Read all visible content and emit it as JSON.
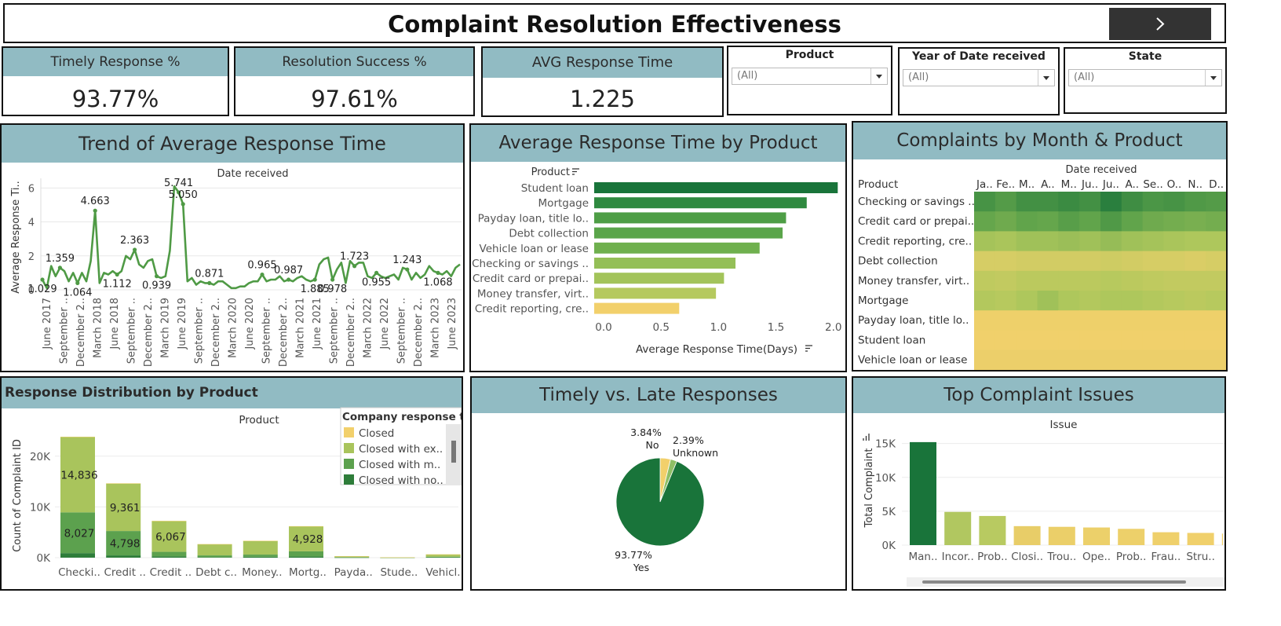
{
  "header": {
    "title": "Complaint Resolution Effectiveness",
    "nav_icon": "chevron-right-icon"
  },
  "kpis": [
    {
      "label": "Timely Response %",
      "value": "93.77%"
    },
    {
      "label": "Resolution Success %",
      "value": "97.61%"
    },
    {
      "label": "AVG Response Time",
      "value": "1.225"
    }
  ],
  "filters": [
    {
      "label": "Product",
      "value": "(All)"
    },
    {
      "label": "Year of Date received",
      "value": "(All)"
    },
    {
      "label": "State",
      "value": "(All)"
    }
  ],
  "colors": {
    "header_bg": "#91bbc3",
    "line": "#4f9a45",
    "dark_green": "#19743a",
    "yellow": "#f2d06b"
  },
  "trend": {
    "title": "Trend of Average Response Time",
    "chart_data": {
      "type": "line",
      "title": "Date received",
      "ylabel": "Average Response Ti..",
      "ylim": [
        0,
        6.2
      ],
      "yticks": [
        0,
        2,
        4,
        6
      ],
      "xticks": [
        "June 2017",
        "September ..",
        "December 2..",
        "March 2018",
        "June 2018",
        "September ..",
        "December 2..",
        "March 2019",
        "June 2019",
        "September ..",
        "December 2..",
        "March 2020",
        "June 2020",
        "September ..",
        "December 2..",
        "March 2021",
        "June 2021",
        "September ..",
        "December 2..",
        "March 2022",
        "June 2022",
        "September ..",
        "December 2..",
        "March 2023",
        "June 2023"
      ],
      "values": [
        0.6,
        0.1,
        1.4,
        0.8,
        1.3,
        1.1,
        0.5,
        1.0,
        0.4,
        1.0,
        0.5,
        1.7,
        4.663,
        0.4,
        1.0,
        0.9,
        1.1,
        0.9,
        1.1,
        2.0,
        1.8,
        2.363,
        1.5,
        1.3,
        1.7,
        1.8,
        0.8,
        0.7,
        0.8,
        2.3,
        6.1,
        5.741,
        5.05,
        0.5,
        0.7,
        0.3,
        0.5,
        0.4,
        0.4,
        0.3,
        0.5,
        0.5,
        0.3,
        0.1,
        0.1,
        0.2,
        0.2,
        0.4,
        0.5,
        0.5,
        0.9,
        0.5,
        0.6,
        0.6,
        0.8,
        0.5,
        0.6,
        0.5,
        0.7,
        0.8,
        0.6,
        0.5,
        0.6,
        1.5,
        1.8,
        1.9,
        0.6,
        1.2,
        1.6,
        0.4,
        1.7,
        1.4,
        1.6,
        1.6,
        0.8,
        0.7,
        1.0,
        0.8,
        0.7,
        0.8,
        0.9,
        0.6,
        1.3,
        1.2,
        0.6,
        1.0,
        0.7,
        0.9,
        1.4,
        1.1,
        1.0,
        0.9,
        1.1,
        0.8,
        1.3,
        1.5
      ],
      "labels": [
        {
          "i": 0,
          "text": "1.029"
        },
        {
          "i": 4,
          "text": "1.359"
        },
        {
          "i": 8,
          "text": "1.064"
        },
        {
          "i": 12,
          "text": "4.663"
        },
        {
          "i": 17,
          "text": "1.112"
        },
        {
          "i": 21,
          "text": "2.363"
        },
        {
          "i": 26,
          "text": "0.939"
        },
        {
          "i": 31,
          "text": "5.741"
        },
        {
          "i": 32,
          "text": "5.050"
        },
        {
          "i": 38,
          "text": "0.871"
        },
        {
          "i": 50,
          "text": "0.965"
        },
        {
          "i": 56,
          "text": "0.987"
        },
        {
          "i": 62,
          "text": "1.885"
        },
        {
          "i": 66,
          "text": "0.978"
        },
        {
          "i": 71,
          "text": "1.723"
        },
        {
          "i": 76,
          "text": "0.955"
        },
        {
          "i": 83,
          "text": "1.243"
        },
        {
          "i": 90,
          "text": "1.068"
        }
      ]
    }
  },
  "avg_by_product": {
    "title": "Average Response Time by Product",
    "chart_data": {
      "type": "bar",
      "orientation": "horizontal",
      "category_header": "Product",
      "xlabel": "Average Response Time(Days)",
      "xlim": [
        0,
        2.2
      ],
      "xticks": [
        "0.0",
        "0.5",
        "1.0",
        "1.5",
        "2.0"
      ],
      "categories": [
        "Student loan",
        "Mortgage",
        "Payday loan, title lo..",
        "Debt collection",
        "Vehicle loan or lease",
        "Checking or savings ..",
        "Credit card or prepai..",
        "Money transfer, virt..",
        "Credit reporting, cre.."
      ],
      "values": [
        2.12,
        1.85,
        1.67,
        1.64,
        1.44,
        1.23,
        1.13,
        1.06,
        0.74
      ],
      "colors": [
        "#19743a",
        "#2f8a40",
        "#4e9e46",
        "#5aa54a",
        "#6fb04e",
        "#94bf57",
        "#a3c45a",
        "#b5c95e",
        "#f2d06b"
      ]
    }
  },
  "heatmap": {
    "title": "Complaints by Month & Product",
    "chart_data": {
      "type": "heatmap",
      "title": "Date received",
      "row_header": "Product",
      "columns": [
        "Ja..",
        "Fe..",
        "M..",
        "A..",
        "M..",
        "Ju..",
        "Ju..",
        "A..",
        "Se..",
        "O..",
        "N..",
        "D.."
      ],
      "rows": [
        "Checking or savings ..",
        "Credit card or prepai..",
        "Credit reporting, cre..",
        "Debt collection",
        "Money transfer, virt..",
        "Mortgage",
        "Payday loan, title lo..",
        "Student loan",
        "Vehicle loan or lease"
      ],
      "values": [
        [
          0.78,
          0.72,
          0.8,
          0.8,
          0.84,
          0.8,
          0.92,
          0.82,
          0.76,
          0.78,
          0.74,
          0.72
        ],
        [
          0.64,
          0.6,
          0.66,
          0.64,
          0.7,
          0.66,
          0.74,
          0.66,
          0.6,
          0.58,
          0.56,
          0.58
        ],
        [
          0.38,
          0.36,
          0.4,
          0.4,
          0.42,
          0.4,
          0.44,
          0.4,
          0.38,
          0.36,
          0.34,
          0.34
        ],
        [
          0.14,
          0.14,
          0.16,
          0.16,
          0.16,
          0.16,
          0.18,
          0.16,
          0.14,
          0.14,
          0.12,
          0.14
        ],
        [
          0.26,
          0.24,
          0.28,
          0.28,
          0.28,
          0.28,
          0.3,
          0.28,
          0.26,
          0.24,
          0.24,
          0.24
        ],
        [
          0.32,
          0.3,
          0.34,
          0.4,
          0.34,
          0.32,
          0.34,
          0.34,
          0.32,
          0.3,
          0.28,
          0.3
        ],
        [
          0.02,
          0.02,
          0.02,
          0.02,
          0.02,
          0.02,
          0.02,
          0.02,
          0.02,
          0.02,
          0.02,
          0.02
        ],
        [
          0.01,
          0.01,
          0.01,
          0.01,
          0.01,
          0.01,
          0.01,
          0.01,
          0.01,
          0.01,
          0.01,
          0.01
        ],
        [
          0.03,
          0.03,
          0.03,
          0.03,
          0.03,
          0.03,
          0.03,
          0.03,
          0.03,
          0.03,
          0.03,
          0.03
        ]
      ]
    }
  },
  "distribution": {
    "title": "Response Distribution by Product",
    "chart_data": {
      "type": "bar",
      "stacked": true,
      "title": "Product",
      "ylabel": "Count of Complaint ID",
      "ylim": [
        0,
        26000
      ],
      "yticks": [
        {
          "v": 0,
          "t": "0K"
        },
        {
          "v": 10000,
          "t": "10K"
        },
        {
          "v": 20000,
          "t": "20K"
        }
      ],
      "categories": [
        "Checki..",
        "Credit ..",
        "Credit ..",
        "Debt c..",
        "Money..",
        "Mortg..",
        "Payda..",
        "Stude..",
        "Vehicl.."
      ],
      "legend_title": "Company response to..",
      "series": [
        {
          "name": "Closed with no..",
          "color": "#2e7d3a",
          "values": [
            900,
            450,
            250,
            100,
            180,
            220,
            30,
            10,
            70
          ]
        },
        {
          "name": "Closed with m..",
          "color": "#5ca14e",
          "values": [
            8027,
            4798,
            900,
            350,
            430,
            1030,
            60,
            20,
            120
          ]
        },
        {
          "name": "Closed with ex..",
          "color": "#a9c45c",
          "values": [
            14836,
            9361,
            6067,
            2200,
            2700,
            4928,
            190,
            30,
            450
          ]
        },
        {
          "name": "Closed",
          "color": "#f2d06b",
          "values": [
            60,
            40,
            30,
            20,
            20,
            30,
            10,
            5,
            10
          ]
        }
      ],
      "data_labels": [
        {
          "cat": 0,
          "text": "14,836"
        },
        {
          "cat": 0,
          "text": "8,027"
        },
        {
          "cat": 1,
          "text": "9,361"
        },
        {
          "cat": 1,
          "text": "4,798"
        },
        {
          "cat": 2,
          "text": "6,067"
        },
        {
          "cat": 5,
          "text": "4,928"
        }
      ],
      "legend_order": [
        "Closed",
        "Closed with ex..",
        "Closed with m..",
        "Closed with no.."
      ]
    }
  },
  "timely": {
    "title": "Timely vs. Late Responses",
    "chart_data": {
      "type": "pie",
      "slices": [
        {
          "label": "Yes",
          "value": 93.77,
          "text": "93.77%",
          "color": "#19743a"
        },
        {
          "label": "No",
          "value": 3.84,
          "text": "3.84%",
          "color": "#f2d06b"
        },
        {
          "label": "Unknown",
          "value": 2.39,
          "text": "2.39%",
          "color": "#8fbf66"
        }
      ]
    }
  },
  "issues": {
    "title": "Top Complaint Issues",
    "chart_data": {
      "type": "bar",
      "title": "Issue",
      "ylabel": "Total Complaint",
      "ylim": [
        0,
        16000
      ],
      "yticks": [
        {
          "v": 0,
          "t": "0K"
        },
        {
          "v": 5000,
          "t": "5K"
        },
        {
          "v": 10000,
          "t": "10K"
        },
        {
          "v": 15000,
          "t": "15K"
        }
      ],
      "categories": [
        "Man..",
        "Incor..",
        "Prob..",
        "Closi..",
        "Trou..",
        "Ope..",
        "Prob..",
        "Frau..",
        "Stru..",
        ""
      ],
      "values": [
        15200,
        4900,
        4300,
        2800,
        2700,
        2600,
        2400,
        1900,
        1800,
        1700
      ],
      "colors": [
        "#19743a",
        "#b1c760",
        "#b8ca61",
        "#e8cd68",
        "#ebcf69",
        "#ecd06a",
        "#edd06a",
        "#efd06b",
        "#f0d06b",
        "#f1d06b"
      ]
    }
  }
}
